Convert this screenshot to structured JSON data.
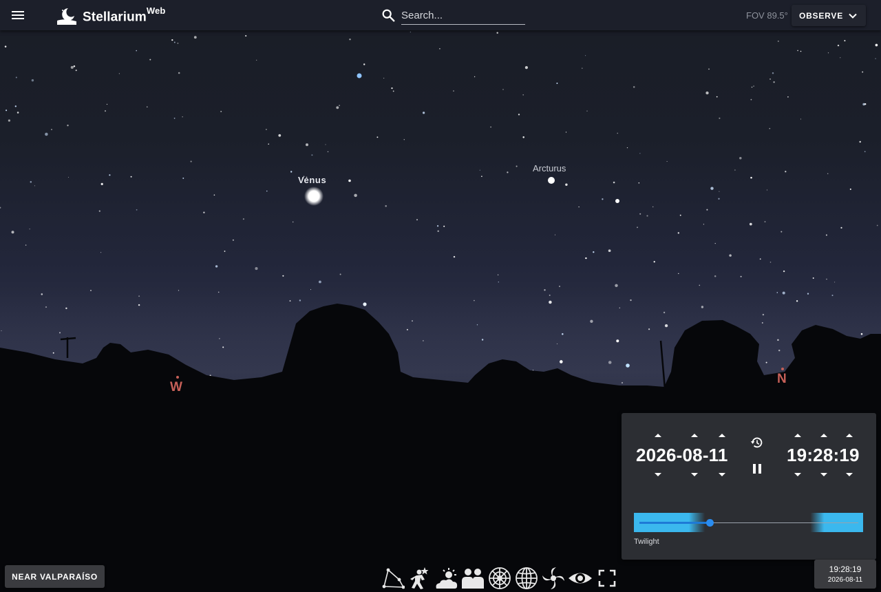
{
  "app": {
    "title": "Stellarium",
    "title_suffix": "Web"
  },
  "search": {
    "placeholder": "Search..."
  },
  "header": {
    "fov": "FOV 89.5°",
    "observe_label": "OBSERVE"
  },
  "sky": {
    "objects": [
      {
        "name": "Venus"
      },
      {
        "name": "Arcturus"
      }
    ],
    "cardinals": [
      {
        "label": "W",
        "color": "#c66058"
      },
      {
        "label": "N",
        "color": "#c66058"
      }
    ]
  },
  "time_panel": {
    "date": "2026-08-11",
    "time": "19:28:19",
    "slider_label": "Twilight",
    "slider_value": 0.32,
    "accent_color": "#3bb8ee"
  },
  "footer": {
    "location": "NEAR VALPARAÍSO",
    "clock_time": "19:28:19",
    "clock_date": "2026-08-11"
  },
  "toolbar": {
    "buttons": [
      {
        "icon": "constellations-lines-icon"
      },
      {
        "icon": "constellations-art-icon"
      },
      {
        "icon": "atmosphere-icon"
      },
      {
        "icon": "landscape-icon"
      },
      {
        "icon": "azimuthal-grid-icon"
      },
      {
        "icon": "equatorial-grid-icon"
      },
      {
        "icon": "deep-sky-objects-icon"
      },
      {
        "icon": "night-mode-eye-icon"
      },
      {
        "icon": "fullscreen-icon"
      }
    ]
  }
}
